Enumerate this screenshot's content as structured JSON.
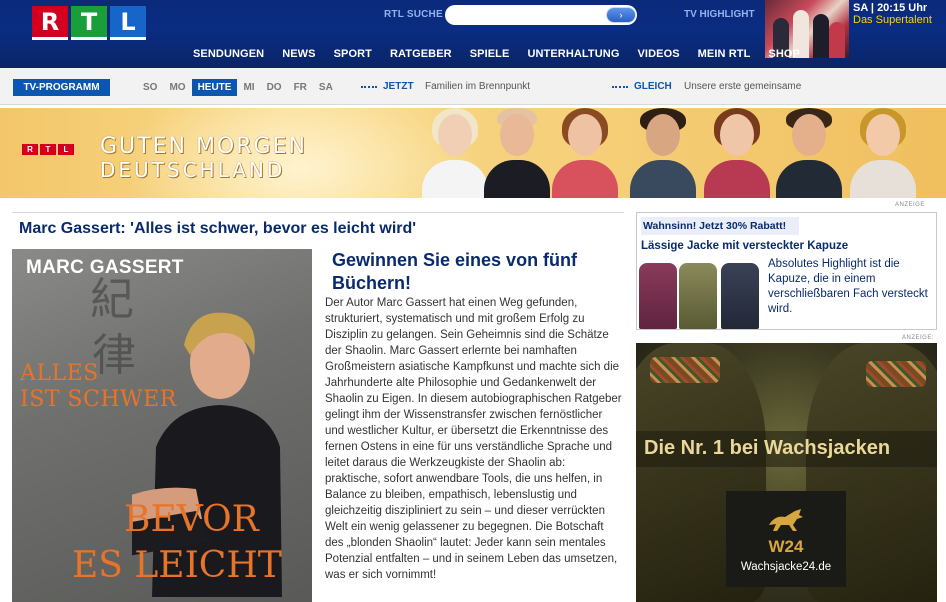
{
  "header": {
    "logo_letters": [
      "R",
      "T",
      "L"
    ],
    "search_label": "RTL SUCHE",
    "search_value": "",
    "search_button_glyph": "›",
    "tv_highlight_label": "TV HIGHLIGHT",
    "tv_highlight_time": "SA | 20:15 Uhr",
    "tv_highlight_show": "Das Supertalent"
  },
  "nav": {
    "items": [
      "SENDUNGEN",
      "NEWS",
      "SPORT",
      "RATGEBER",
      "SPIELE",
      "UNTERHALTUNG",
      "VIDEOS",
      "MEIN RTL",
      "SHOP"
    ]
  },
  "tvbar": {
    "tab_label": "TV-PROGRAMM",
    "days": [
      "SO",
      "MO",
      "HEUTE",
      "MI",
      "DO",
      "FR",
      "SA"
    ],
    "active_day": "HEUTE",
    "now_label": "JETZT",
    "now_show": "Familien im Brennpunkt",
    "next_label": "GLEICH",
    "next_show": "Unsere erste gemeinsame"
  },
  "banner": {
    "logo_letters": [
      "R",
      "T",
      "L"
    ],
    "title_line_1": "GUTEN MORGEN",
    "title_line_2": "DEUTSCHLAND"
  },
  "article": {
    "headline": "Marc Gassert: 'Alles ist schwer, bevor es leicht wird'",
    "cover": {
      "author": "MARC GASSERT",
      "kanji_1": "紀",
      "kanji_2": "律",
      "subtitle_line_1": "ALLES",
      "subtitle_line_2": "IST SCHWER",
      "title_line_1": "BEVOR",
      "title_line_2": "ES LEICHT"
    },
    "promo_title": "Gewinnen Sie eines von fünf Büchern!",
    "body": "Der Autor Marc Gassert hat einen Weg gefunden, strukturiert, systematisch und mit großem Erfolg zu Disziplin zu gelangen. Sein Geheimnis sind die Schätze der Shaolin. Marc Gassert erlernte bei namhaften Großmeistern asiatische Kampfkunst und machte sich die Jahrhunderte alte Philosophie und Gedankenwelt der Shaolin zu Eigen. In diesem autobiographischen Ratgeber gelingt ihm der Wissenstransfer zwischen fernöstlicher und westlicher Kultur, er übersetzt die Erkenntnisse des fernen Ostens in eine für uns verständliche Sprache und leitet daraus die Werkzeugkiste der Shaolin ab: praktische, sofort anwendbare Tools, die uns helfen, in Balance zu bleiben, empathisch, lebenslustig und gleichzeitig diszipliniert zu sein – und dieser verrückten Welt ein wenig gelassener zu begegnen. Die Botschaft des „blonden Shaolin“ lautet: Jeder kann sein mentales Potenzial entfalten – und in seinem Leben das umsetzen, was er sich vornimmt!"
  },
  "ads": {
    "anzeige_label": "ANZEIGE",
    "anzeige_label_2": "ANZEIGE:",
    "jacket_ad": {
      "badge": "Wahnsinn! Jetzt 30% Rabatt!",
      "title": "Lässige Jacke mit versteckter Kapuze",
      "text": "Absolutes Highlight ist die Kapuze, die in einem verschließbaren Fach versteckt wird."
    },
    "wax_ad": {
      "headline": "Die Nr. 1 bei Wachsjacken",
      "brand": "W24",
      "domain": "Wachsjacke24.de"
    }
  },
  "colors": {
    "header_blue": "#0a2c82",
    "nav_active_blue": "#0a56b0",
    "headline_navy": "#0a2a6e",
    "rtl_red": "#d2001e",
    "rtl_green": "#1a9e3a",
    "rtl_blue": "#1566c8",
    "cover_orange": "#e8742a",
    "highlight_yellow": "#ffd400"
  },
  "icons": {
    "search_button": "arrow-right-icon",
    "ad_horse": "horse-icon"
  }
}
